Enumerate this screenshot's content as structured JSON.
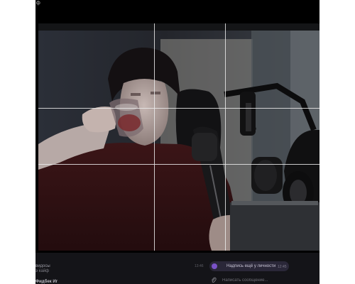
{
  "window": {
    "title": "ф"
  },
  "camera": {
    "grid": "rule-of-thirds"
  },
  "chat": {
    "items": [
      {
        "name": "видосы",
        "snippet": "э кайф",
        "time": "13:46"
      },
      {
        "name": "Фидбек Иг"
      }
    ],
    "message": {
      "text": "Надпись ещё у личности",
      "time": "12:45"
    },
    "composer": {
      "placeholder": "Написать сообщение..."
    },
    "colors": {
      "accent": "#7a52c7",
      "background": "#141418"
    },
    "icons": {
      "attach": "paperclip-icon"
    }
  }
}
